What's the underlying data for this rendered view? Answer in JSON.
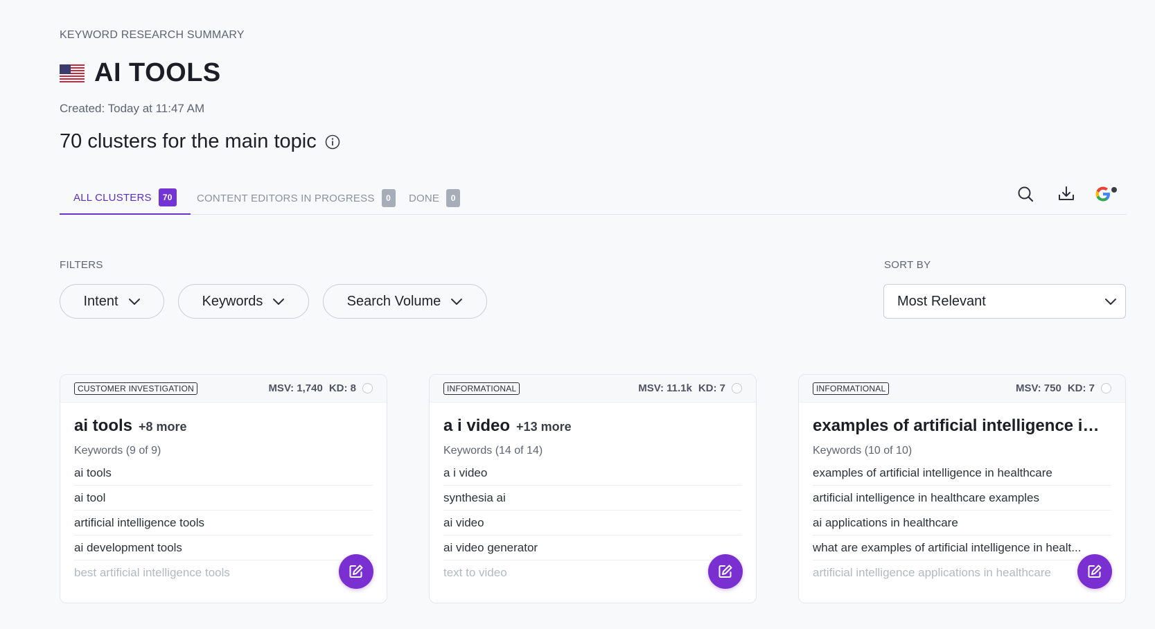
{
  "header": {
    "eyebrow": "KEYWORD RESEARCH SUMMARY",
    "title": "AI TOOLS",
    "flag_icon": "us-flag-icon",
    "created": "Created: Today at 11:47 AM",
    "subtitle": "70 clusters for the main topic"
  },
  "tabs": [
    {
      "label": "ALL CLUSTERS",
      "count": "70",
      "active": true
    },
    {
      "label": "CONTENT EDITORS IN PROGRESS",
      "count": "0",
      "active": false
    },
    {
      "label": "DONE",
      "count": "0",
      "active": false
    }
  ],
  "toolbar": {
    "icons": [
      "search-icon",
      "download-icon",
      "google-icon"
    ]
  },
  "filters": {
    "label": "FILTERS",
    "buttons": [
      "Intent",
      "Keywords",
      "Search Volume"
    ]
  },
  "sort": {
    "label": "SORT BY",
    "value": "Most Relevant"
  },
  "cards": [
    {
      "intent": "CUSTOMER INVESTIGATION",
      "msv": "MSV: 1,740",
      "kd": "KD: 8",
      "title": "ai tools",
      "more": "+8 more",
      "keyword_count": "Keywords (9 of 9)",
      "keywords": [
        "ai tools",
        "ai tool",
        "artificial intelligence tools",
        "ai development tools",
        "best artificial intelligence tools"
      ]
    },
    {
      "intent": "INFORMATIONAL",
      "msv": "MSV: 11.1k",
      "kd": "KD: 7",
      "title": "a i video",
      "more": "+13 more",
      "keyword_count": "Keywords (14 of 14)",
      "keywords": [
        "a i video",
        "synthesia ai",
        "ai video",
        "ai video generator",
        "text to video"
      ]
    },
    {
      "intent": "INFORMATIONAL",
      "msv": "MSV: 750",
      "kd": "KD: 7",
      "title": "examples of artificial intelligence in...",
      "more": "",
      "keyword_count": "Keywords (10 of 10)",
      "keywords": [
        "examples of artificial intelligence in healthcare",
        "artificial intelligence in healthcare examples",
        "ai applications in healthcare",
        "what are examples of artificial intelligence in healt...",
        "artificial intelligence applications in healthcare"
      ]
    }
  ],
  "colors": {
    "accent": "#7234d4",
    "fab": "#7a2fd0",
    "background": "#f8f9fb"
  }
}
